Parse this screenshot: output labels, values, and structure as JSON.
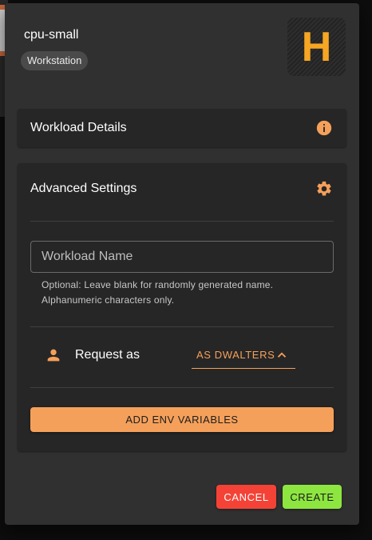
{
  "colors": {
    "accent": "#f5a05a",
    "logo": "#f5a623",
    "cancel": "#f44336",
    "create": "#8de640",
    "dialog_bg": "#303030",
    "section_bg": "#262626"
  },
  "dialog": {
    "title": "cpu-small",
    "chip": "Workstation",
    "logo_letter": "H"
  },
  "workload_details": {
    "title": "Workload Details",
    "icon": "info-icon"
  },
  "advanced": {
    "title": "Advanced Settings",
    "icon": "gear-icon",
    "name_field": {
      "value": "",
      "placeholder": "Workload Name",
      "helper_line1": "Optional: Leave blank for randomly generated name.",
      "helper_line2": "Alphanumeric characters only."
    },
    "request_as": {
      "label": "Request as",
      "icon": "person-icon",
      "selected": "AS DWALTERS",
      "chevron": "chevron-up-icon"
    },
    "env_button": "ADD ENV VARIABLES"
  },
  "actions": {
    "cancel": "CANCEL",
    "create": "CREATE"
  }
}
